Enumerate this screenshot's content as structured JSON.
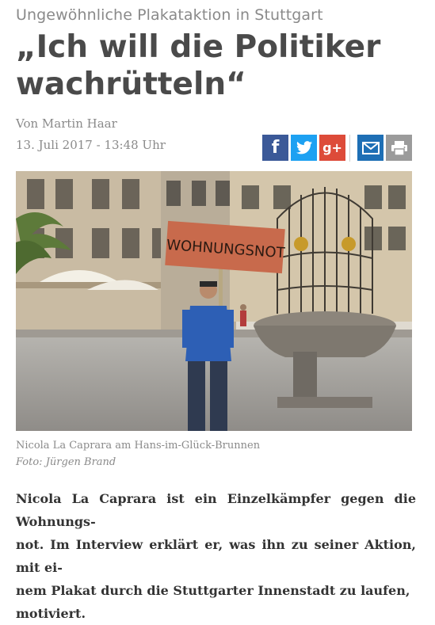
{
  "article": {
    "kicker": "Ungewöhnliche Plakataktion in Stuttgart",
    "headline_line1": "„Ich will die Politiker",
    "headline_line2": "wachrütteln“",
    "author": "Von Martin Haar",
    "date": "13. Juli 2017 - 13:48 Uhr"
  },
  "share": {
    "facebook_glyph": "f",
    "googleplus_glyph": "g+",
    "icons": [
      "facebook-icon",
      "twitter-icon",
      "google-plus-icon",
      "mail-icon",
      "print-icon"
    ],
    "colors": {
      "facebook": "#3b5998",
      "twitter": "#1da1f2",
      "googleplus": "#dd4b39",
      "mail": "#1e6fb5",
      "print": "#9b9b9b"
    }
  },
  "photo": {
    "sign_text": "WOHNUNGSNOT",
    "caption": "Nicola La Caprara am Hans-im-Glück-Brunnen",
    "credit": "Foto: Jürgen Brand"
  },
  "lead": {
    "line1": "Nicola La Caprara ist ein Einzelkämpfer gegen die Wohnungs-",
    "line2": "not. Im Interview erklärt er, was ihn zu seiner Aktion, mit ei-",
    "line3": "nem Plakat durch die Stuttgarter Innenstadt zu laufen,",
    "line4": "motiviert."
  }
}
